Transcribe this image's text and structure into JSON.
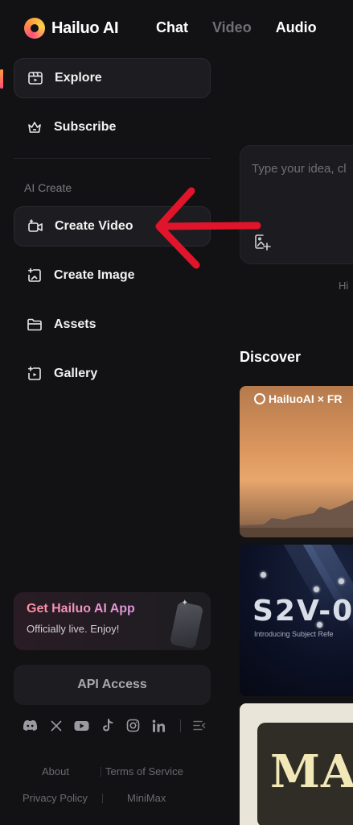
{
  "app": {
    "name": "Hailuo AI"
  },
  "top_tabs": [
    {
      "label": "Chat",
      "active": true
    },
    {
      "label": "Video",
      "active": false
    },
    {
      "label": "Audio",
      "active": true
    }
  ],
  "sidebar": {
    "items": [
      {
        "label": "Explore",
        "icon": "explore-icon",
        "active": true
      },
      {
        "label": "Subscribe",
        "icon": "crown-icon",
        "active": false
      }
    ],
    "section_label": "AI Create",
    "create_items": [
      {
        "label": "Create Video",
        "icon": "video-camera-icon",
        "active": true
      },
      {
        "label": "Create Image",
        "icon": "image-sparkle-icon",
        "active": false
      },
      {
        "label": "Assets",
        "icon": "folder-icon",
        "active": false
      },
      {
        "label": "Gallery",
        "icon": "gallery-icon",
        "active": false
      }
    ],
    "app_promo": {
      "title": "Get Hailuo AI App",
      "subtitle": "Officially live. Enjoy!"
    },
    "api_access": "API Access",
    "socials": [
      "discord-icon",
      "x-icon",
      "youtube-icon",
      "tiktok-icon",
      "instagram-icon",
      "linkedin-icon",
      "collapse-icon"
    ],
    "footer_links": [
      "About",
      "Terms of Service",
      "Privacy Policy",
      "MiniMax"
    ]
  },
  "main": {
    "prompt_placeholder": "Type your idea, cl",
    "hint_text": "Hi",
    "discover_title": "Discover",
    "cards": [
      {
        "brand": "HailuoAI",
        "partner": "× FR"
      },
      {
        "title": "S2V-0",
        "subtitle": "Introducing Subject Refe"
      },
      {
        "title": "MAT"
      }
    ]
  },
  "colors": {
    "background": "#121214",
    "panel": "#1d1d21",
    "accent_annotation": "#e0142a",
    "brand_gradient_start": "#ff4f7b",
    "brand_gradient_end": "#ffd24a"
  }
}
